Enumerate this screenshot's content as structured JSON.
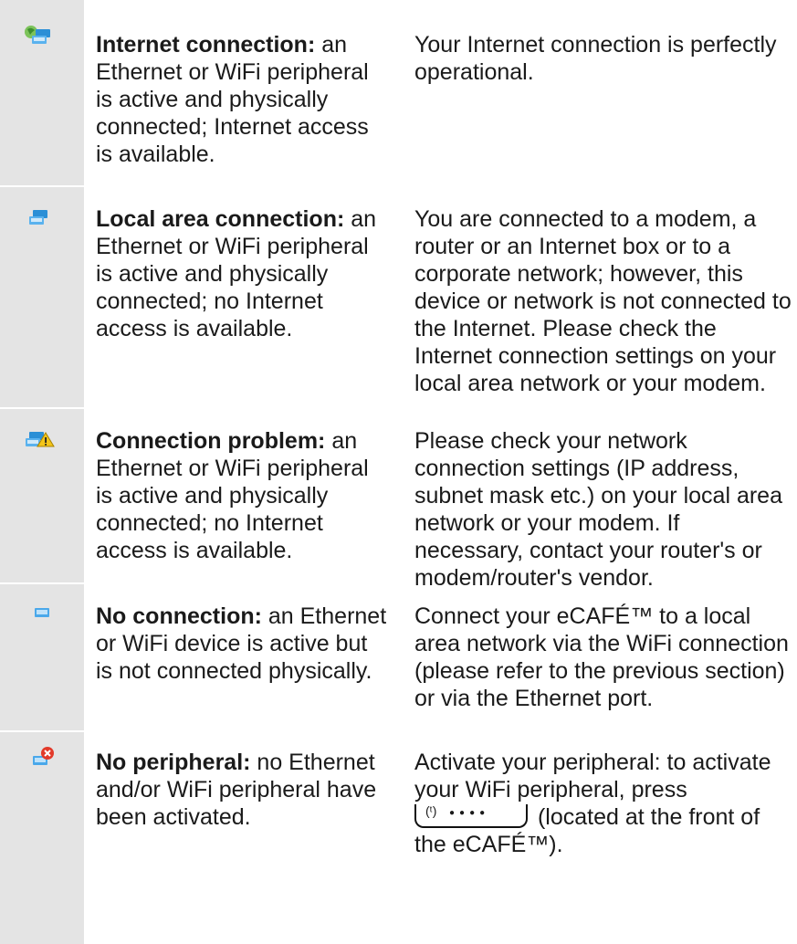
{
  "rows": [
    {
      "icon": "internet-connection-icon",
      "title": "Internet connection:",
      "desc": " an Ethernet or WiFi peripheral is active and physically connected; Internet access is available.",
      "detail": "Your Internet connection is perfectly operational."
    },
    {
      "icon": "local-area-connection-icon",
      "title": "Local area connection:",
      "desc": " an Ethernet or WiFi peripheral is active and physically connected; no Internet access is available.",
      "detail": "You are connected to a modem, a router or an Internet box or to a corporate network; however, this device or network is not connected to the Internet. Please check the Internet connection settings on your local area network or your modem."
    },
    {
      "icon": "connection-problem-icon",
      "title": "Connection problem:",
      "desc": " an Ethernet or WiFi peripheral is active and physically connected; no Internet access is available.",
      "detail": "Please check your network connection settings (IP address, subnet mask etc.) on your local area network or your modem. If necessary, contact your router's or modem/router's vendor."
    },
    {
      "icon": "no-connection-icon",
      "title": "No connection:",
      "desc": " an Ethernet or WiFi device is active but is not connected physically.",
      "detail": "Connect your eCAFÉ™ to a local area network via the WiFi connection (please refer to the previous section) or via the Ethernet port."
    },
    {
      "icon": "no-peripheral-icon",
      "title": "No peripheral:",
      "desc": " no Ethernet and/or WiFi peripheral have been activated.",
      "detail_before": "Activate your peripheral: to activate your WiFi peripheral, press",
      "detail_after": " (located at the front of the eCAFÉ™).",
      "key_icon": "wifi-key-icon"
    }
  ]
}
